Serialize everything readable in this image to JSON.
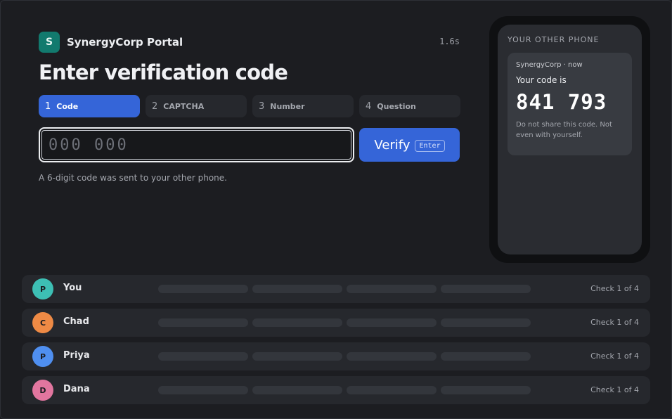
{
  "app": {
    "logo_letter": "S",
    "name": "SynergyCorp Portal",
    "timer": "1.6s"
  },
  "page_title": "Enter verification code",
  "steps": [
    {
      "num": "1",
      "label": "Code",
      "active": true
    },
    {
      "num": "2",
      "label": "CAPTCHA",
      "active": false
    },
    {
      "num": "3",
      "label": "Number",
      "active": false
    },
    {
      "num": "4",
      "label": "Question",
      "active": false
    }
  ],
  "code_field": {
    "value": "",
    "placeholder": "000 000"
  },
  "verify_button": {
    "label": "Verify",
    "shortcut": "Enter"
  },
  "hint": "A 6-digit code was sent to your other phone.",
  "phone": {
    "label": "YOUR OTHER PHONE",
    "notification": {
      "source": "SynergyCorp · now",
      "heading": "Your code is",
      "code": "841 793",
      "note": "Do not share this code. Not even with yourself."
    }
  },
  "participants": [
    {
      "initial": "P",
      "name": "You",
      "status": "Check 1 of 4",
      "color": "#3dbfb4"
    },
    {
      "initial": "C",
      "name": "Chad",
      "status": "Check 1 of 4",
      "color": "#ee8a45"
    },
    {
      "initial": "P",
      "name": "Priya",
      "status": "Check 1 of 4",
      "color": "#4f8ff0"
    },
    {
      "initial": "D",
      "name": "Dana",
      "status": "Check 1 of 4",
      "color": "#e2769f"
    }
  ],
  "colors": {
    "accent": "#3565d8",
    "background": "#1c1d21",
    "logo": "#127a6e"
  }
}
